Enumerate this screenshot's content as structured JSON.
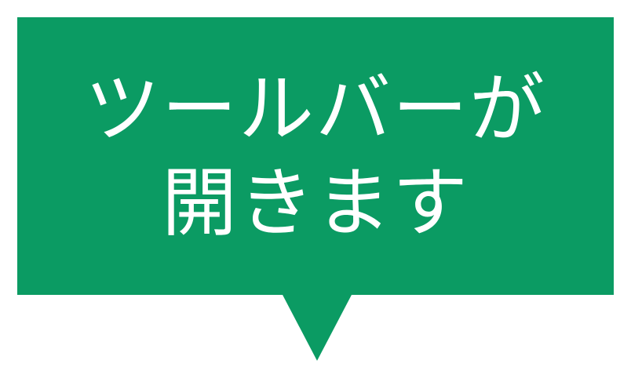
{
  "callout": {
    "line1": "ツールバーが",
    "line2": "開きます",
    "color": "#0b9b63",
    "text_color": "#ffffff"
  }
}
